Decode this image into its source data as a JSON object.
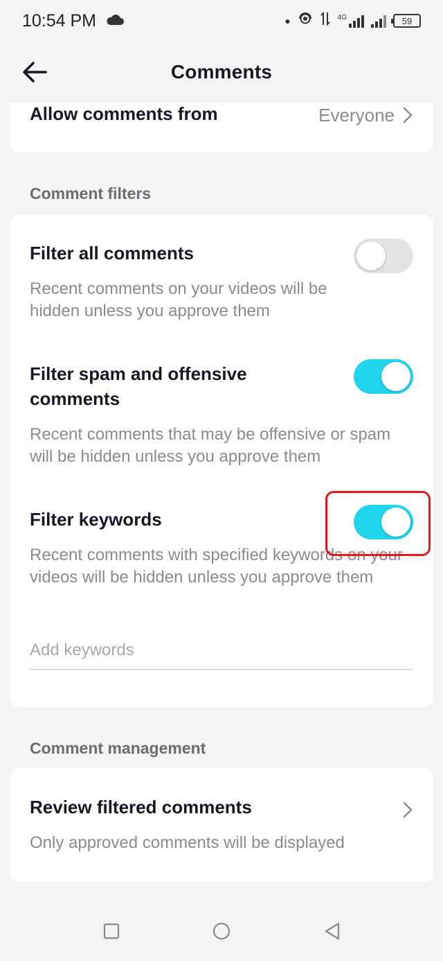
{
  "status_bar": {
    "time": "10:54 PM",
    "cloud_icon": "cloud-icon",
    "network_label": "4G",
    "battery": "59"
  },
  "nav": {
    "title": "Comments",
    "back_icon": "arrow-left-icon"
  },
  "allow_comments": {
    "label": "Allow comments from",
    "value": "Everyone"
  },
  "comment_filters": {
    "header": "Comment filters",
    "items": [
      {
        "title": "Filter all comments",
        "description": "Recent comments on your videos will be hidden unless you approve them",
        "enabled": false
      },
      {
        "title": "Filter spam and offensive comments",
        "description": "Recent comments that may be offensive or spam will be hidden unless you approve them",
        "enabled": true
      },
      {
        "title": "Filter keywords",
        "description": "Recent comments with specified keywords on your videos will be hidden unless you approve them",
        "enabled": true
      }
    ],
    "keywords_placeholder": "Add keywords"
  },
  "comment_management": {
    "header": "Comment management",
    "review_title": "Review filtered comments",
    "review_description": "Only approved comments will be displayed"
  },
  "colors": {
    "toggle_on": "#20d5ec",
    "toggle_off": "#e3e3e4",
    "highlight": "#e0181f"
  },
  "system_nav": [
    "square-icon",
    "circle-icon",
    "triangle-back-icon"
  ]
}
